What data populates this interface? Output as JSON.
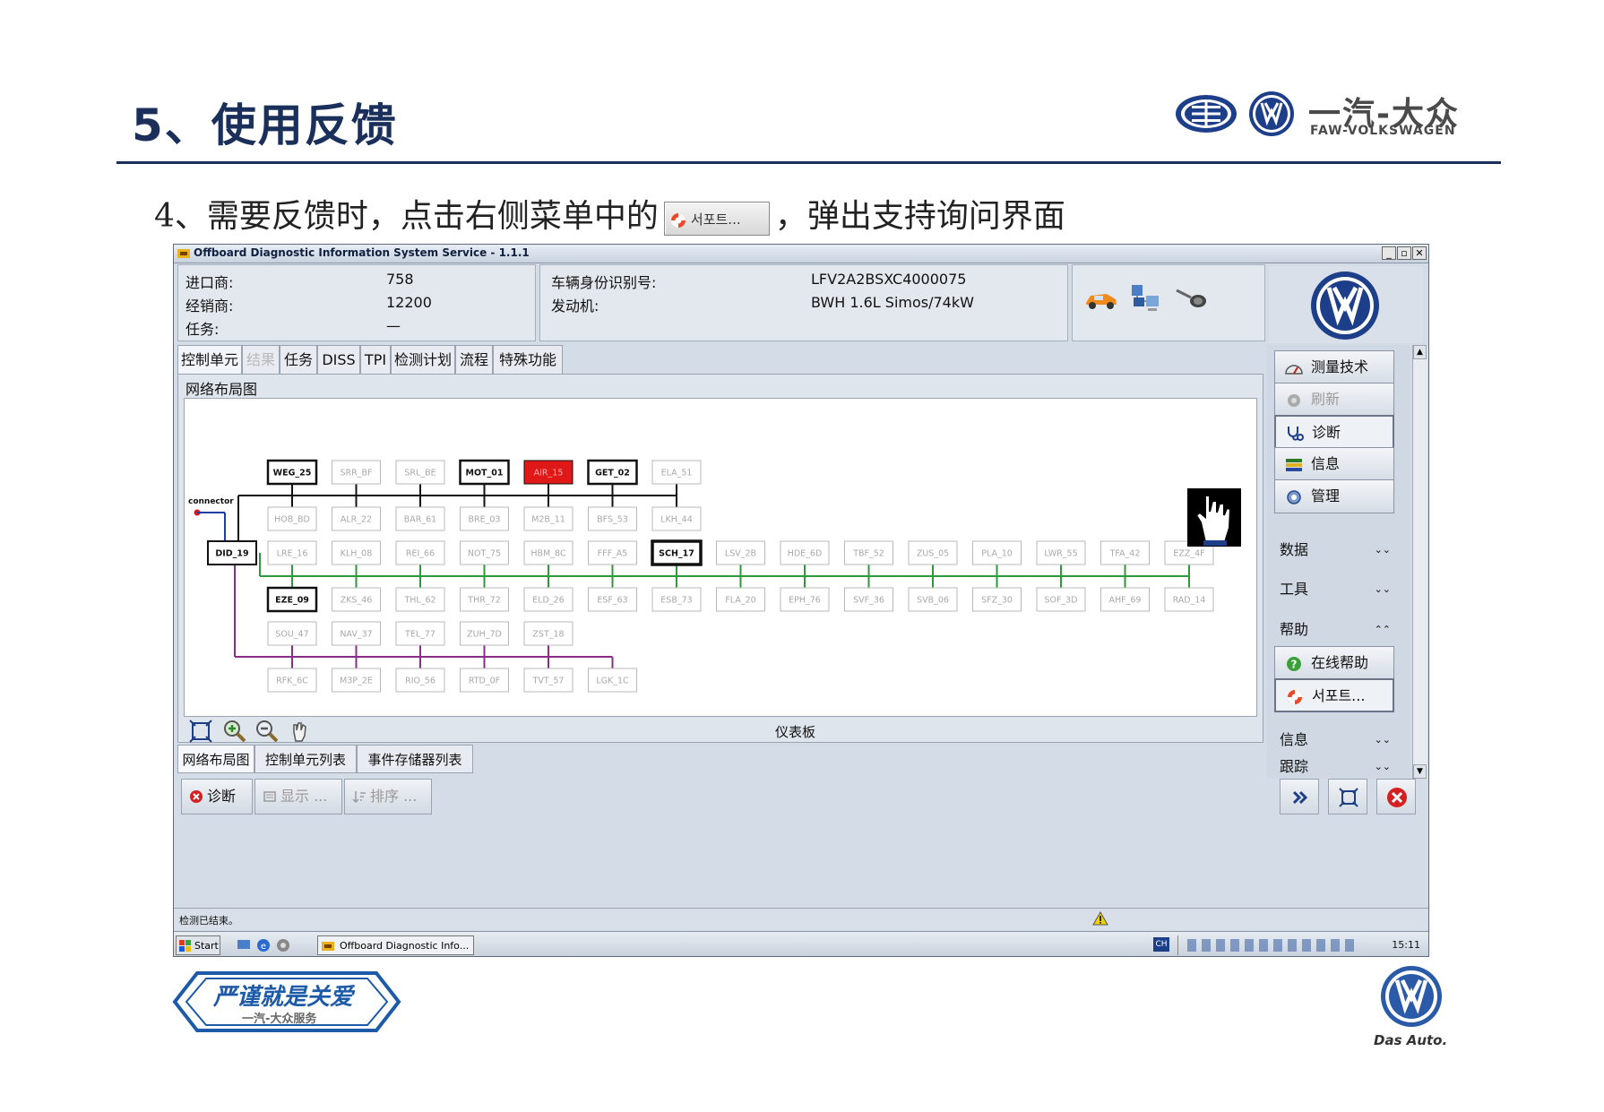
{
  "slide": {
    "title": "5、使用反馈",
    "instruction_before": "4、需要反馈时，点击右侧菜单中的",
    "instruction_button": "서포트...",
    "instruction_after": "，弹出支持询问界面"
  },
  "brand": {
    "cn": "一汽-大众",
    "en": "FAW-VOLKSWAGEN",
    "slogan_main": "严谨就是关爱",
    "slogan_sub": "一汽-大众服务",
    "das_auto": "Das Auto."
  },
  "window": {
    "title": "Offboard Diagnostic Information System Service - 1.1.1",
    "header": {
      "importer_label": "进口商:",
      "importer_value": "758",
      "dealer_label": "经销商:",
      "dealer_value": "12200",
      "task_label": "任务:",
      "task_value": "—",
      "vin_label": "车辆身份识别号:",
      "vin_value": "LFV2A2BSXC4000075",
      "engine_label": "发动机:",
      "engine_value": "BWH 1.6L Simos/74kW"
    },
    "tabs": [
      "控制单元",
      "结果",
      "任务",
      "DISS",
      "TPI",
      "检测计划",
      "流程",
      "特殊功能"
    ],
    "panel_title": "网络布局图",
    "connector_label": "connector",
    "center_label": "仪表板",
    "subtabs": [
      "网络布局图",
      "控制单元列表",
      "事件存储器列表"
    ],
    "bottom_buttons": {
      "diagnose": "诊断",
      "display": "显示 ...",
      "sort": "排序 ..."
    },
    "status_text": "检测已结束。",
    "taskbar": {
      "start": "Start",
      "task_item": "Offboard Diagnostic Info...",
      "lang": "CH",
      "clock": "15:11"
    },
    "right_panel": {
      "buttons": [
        "测量技术",
        "刷新",
        "诊断",
        "信息",
        "管理"
      ],
      "sections": [
        "数据",
        "工具",
        "帮助"
      ],
      "help_items": [
        "在线帮助",
        "서포트..."
      ],
      "lower_sections": [
        "信息",
        "跟踪"
      ]
    }
  },
  "network": {
    "gateway": "DID_19",
    "rows": [
      [
        "WEG_25",
        "SRR_BF",
        "SRL_BE",
        "MOT_01",
        "AIR_15",
        "GET_02",
        "ELA_51"
      ],
      [
        "HOB_BD",
        "ALR_22",
        "BAR_61",
        "BRE_03",
        "M2B_11",
        "BFS_53",
        "LKH_44"
      ],
      [
        "LRE_16",
        "KLH_08",
        "REI_66",
        "NOT_75",
        "HBM_8C",
        "FFF_A5",
        "SCH_17",
        "LSV_2B",
        "HDE_6D",
        "TBF_52",
        "ZUS_05",
        "PLA_10",
        "LWR_55",
        "TFA_42",
        "EZZ_4F"
      ],
      [
        "EZE_09",
        "ZKS_46",
        "THL_62",
        "THR_72",
        "ELD_26",
        "ESF_63",
        "ESB_73",
        "FLA_20",
        "EPH_76",
        "SVF_36",
        "SVB_06",
        "SFZ_30",
        "SOF_3D",
        "AHF_69",
        "RAD_14"
      ],
      [
        "SOU_47",
        "NAV_37",
        "TEL_77",
        "ZUH_7D",
        "ZST_18"
      ],
      [
        "RFK_6C",
        "M3P_2E",
        "RIO_56",
        "RTD_0F",
        "TVT_57",
        "LGK_1C"
      ]
    ],
    "active": [
      "WEG_25",
      "MOT_01",
      "GET_02",
      "SCH_17",
      "EZE_09"
    ],
    "error": [
      "AIR_15"
    ],
    "colors": {
      "black_bus": "#111111",
      "green_bus": "#2c9a3a",
      "purple_bus": "#8a2c8a",
      "blue_bus": "#1f3fa8",
      "error": "#e01818",
      "inactive_text": "#a8a8a8"
    }
  }
}
